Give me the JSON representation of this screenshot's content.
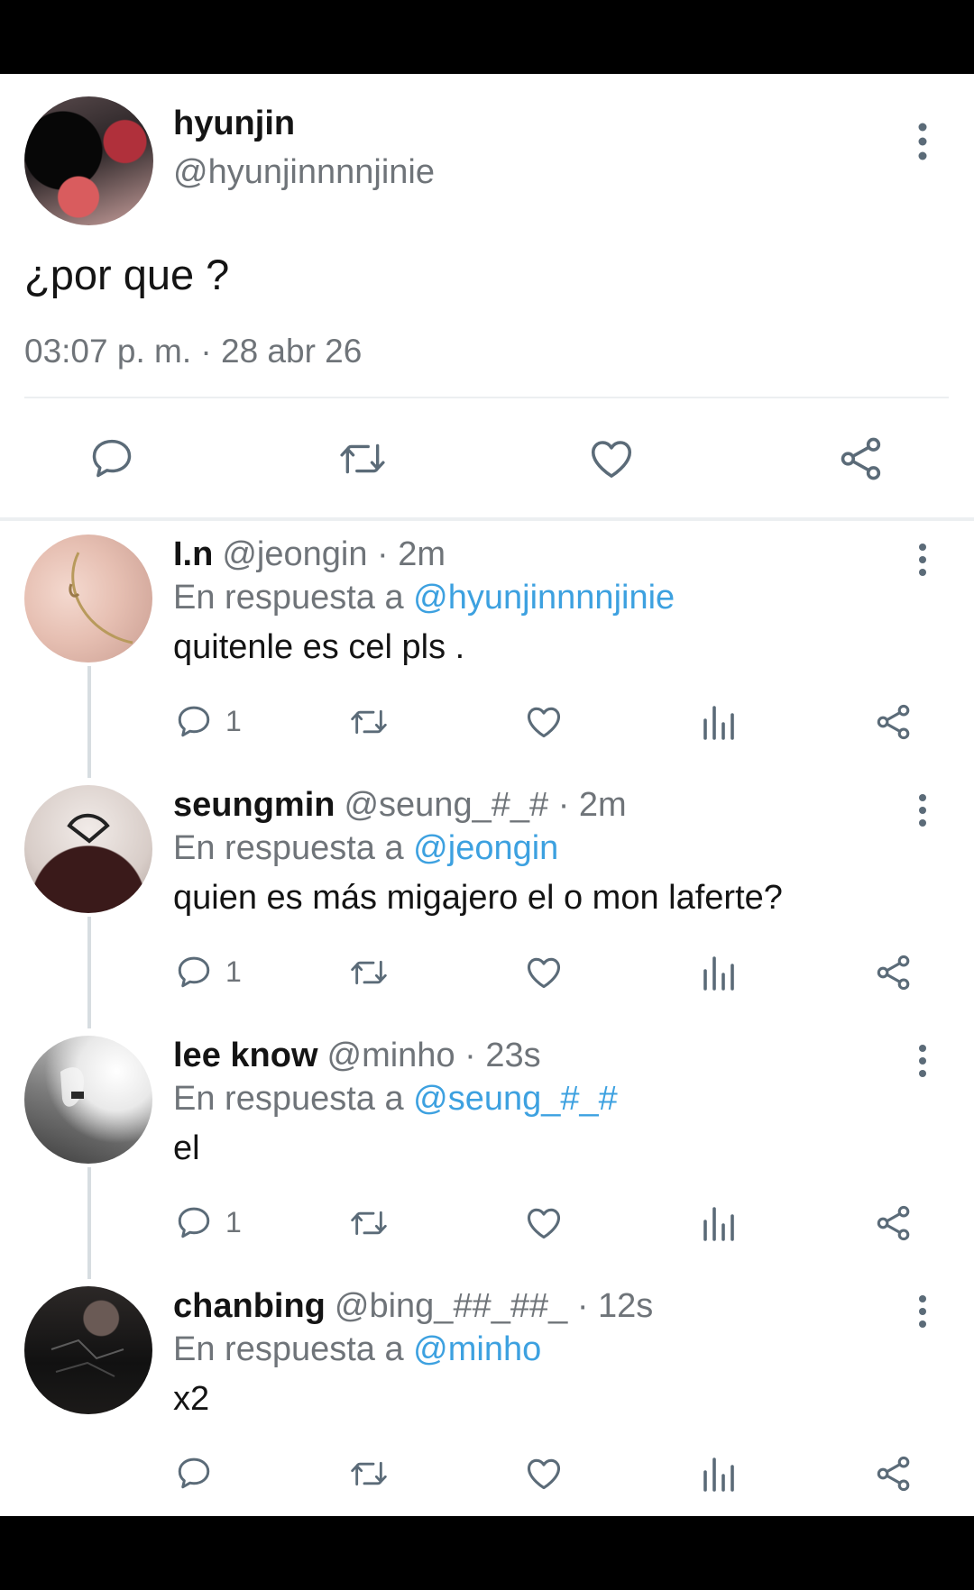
{
  "main_tweet": {
    "name": "hyunjin",
    "handle": "@hyunjinnnnjinie",
    "text": "¿por que ?",
    "timestamp": "03:07 p. m. · 28 abr 26",
    "actions": [
      "reply-icon",
      "retweet-icon",
      "like-icon",
      "share-icon"
    ]
  },
  "replies": [
    {
      "name": "I.n",
      "handle": "@jeongin",
      "time": "· 2m",
      "reply_prefix": "En respuesta a",
      "reply_to": "@hyunjinnnnjinie",
      "text": "quitenle es cel pls .",
      "reply_count": "1"
    },
    {
      "name": "seungmin",
      "handle": "@seung_#_#",
      "time": "· 2m",
      "reply_prefix": "En respuesta a",
      "reply_to": "@jeongin",
      "text": "quien es más migajero el o mon laferte?",
      "reply_count": "1"
    },
    {
      "name": "lee know",
      "handle": "@minho",
      "time": "· 23s",
      "reply_prefix": "En respuesta a",
      "reply_to": "@seung_#_#",
      "text": "el",
      "reply_count": "1"
    },
    {
      "name": "chanbing",
      "handle": "@bing_##_##_",
      "time": "· 12s",
      "reply_prefix": "En respuesta a",
      "reply_to": "@minho",
      "text": "x2",
      "reply_count": ""
    }
  ],
  "colors": {
    "accent": "#3da1e0",
    "text": "#141414",
    "secondary": "#6f7479",
    "icon": "#5b6b78"
  }
}
